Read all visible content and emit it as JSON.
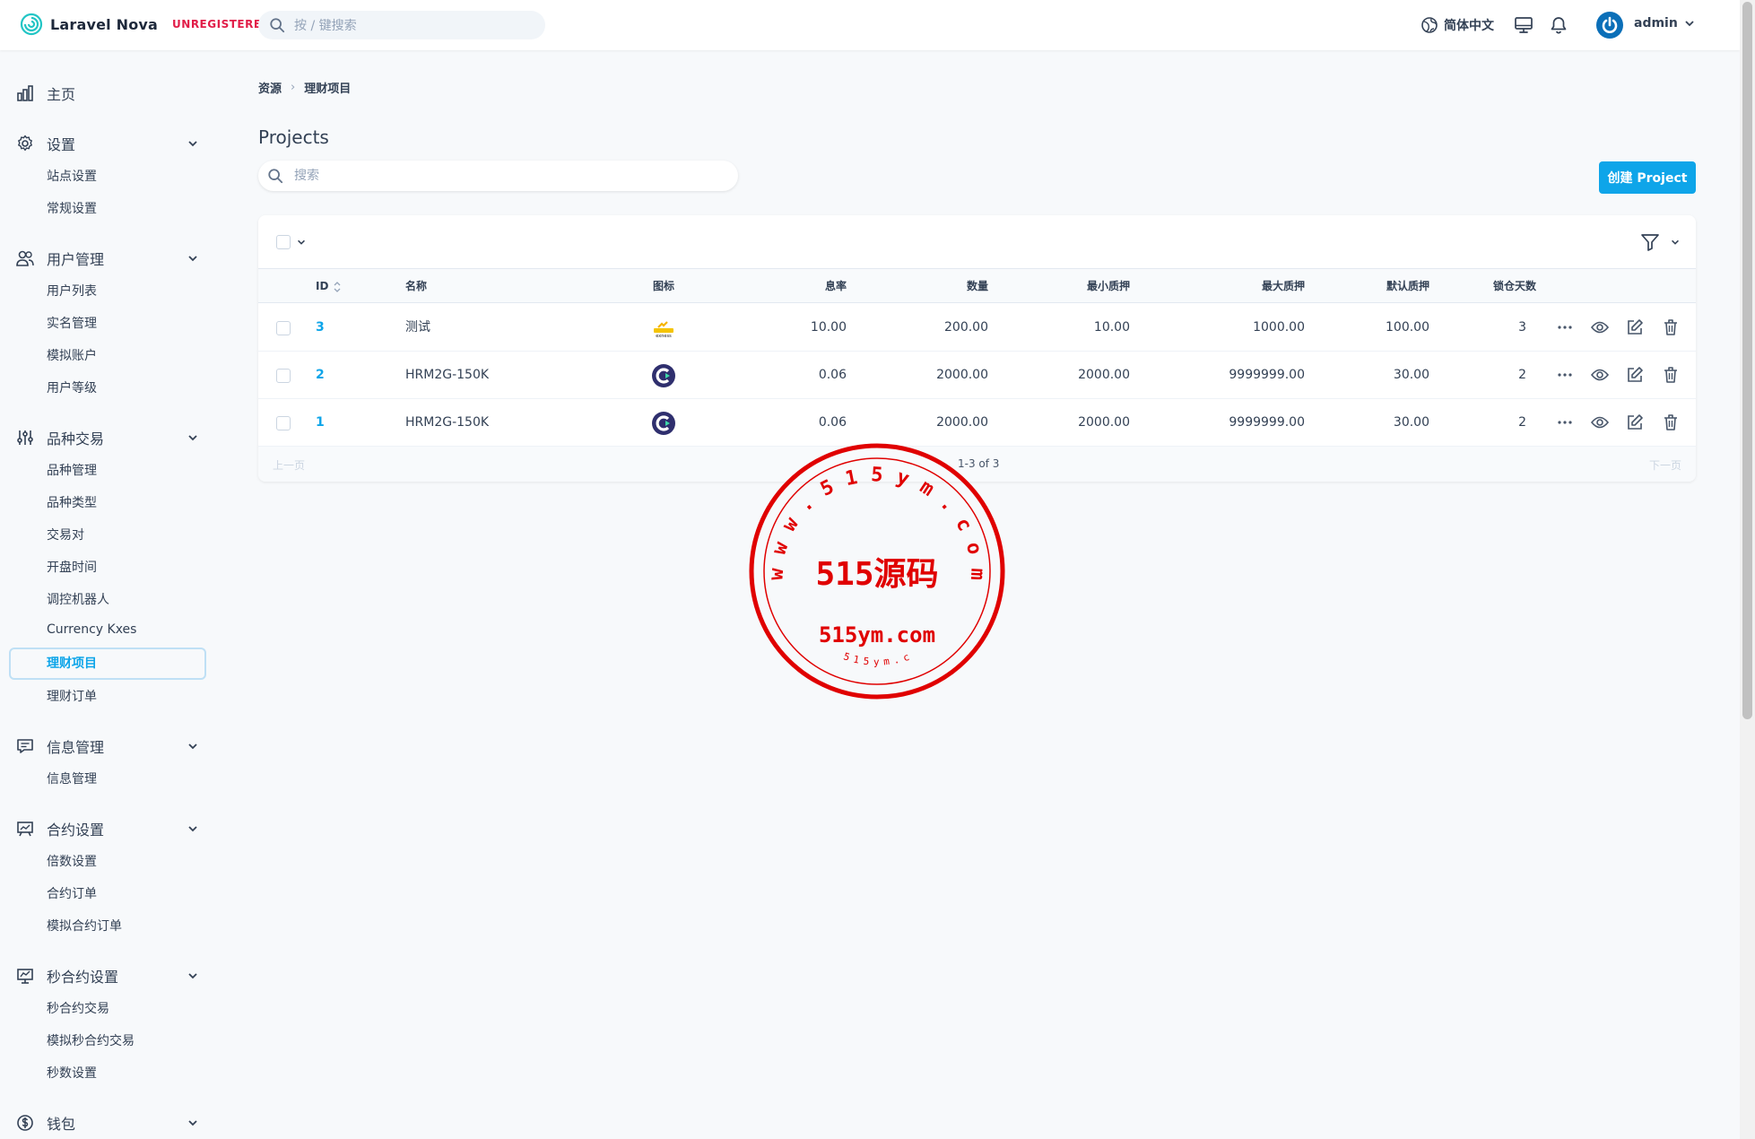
{
  "app": {
    "name": "Laravel Nova",
    "badge": "UNREGISTERED",
    "search_placeholder": "按 / 键搜索",
    "language": "简体中文",
    "user": "admin"
  },
  "sidebar": {
    "home": "主页",
    "groups": [
      {
        "label": "设置",
        "icon": "gear-icon",
        "items": [
          "站点设置",
          "常规设置"
        ]
      },
      {
        "label": "用户管理",
        "icon": "users-icon",
        "items": [
          "用户列表",
          "实名管理",
          "模拟账户",
          "用户等级"
        ]
      },
      {
        "label": "品种交易",
        "icon": "sliders-icon",
        "items": [
          "品种管理",
          "品种类型",
          "交易对",
          "开盘时间",
          "调控机器人",
          "Currency Kxes",
          "理财项目",
          "理财订单"
        ]
      },
      {
        "label": "信息管理",
        "icon": "message-icon",
        "items": [
          "信息管理"
        ]
      },
      {
        "label": "合约设置",
        "icon": "presentation-icon",
        "items": [
          "倍数设置",
          "合约订单",
          "模拟合约订单"
        ]
      },
      {
        "label": "秒合约设置",
        "icon": "chart-icon",
        "items": [
          "秒合约交易",
          "模拟秒合约交易",
          "秒数设置"
        ]
      },
      {
        "label": "钱包",
        "icon": "dollar-icon",
        "items": []
      }
    ],
    "active": "理财项目"
  },
  "breadcrumb": [
    "资源",
    "理财项目"
  ],
  "page": {
    "title": "Projects",
    "search_placeholder": "搜索",
    "create_label": "创建 Project"
  },
  "table": {
    "headers": {
      "id": "ID",
      "name": "名称",
      "icon": "图标",
      "rate": "息率",
      "qty": "数量",
      "min": "最小质押",
      "max": "最大质押",
      "def": "默认质押",
      "days": "锁仓天数"
    },
    "rows": [
      {
        "id": "3",
        "name": "测试",
        "logo": "exness",
        "rate": "10.00",
        "qty": "200.00",
        "min": "10.00",
        "max": "1000.00",
        "def": "100.00",
        "days": "3"
      },
      {
        "id": "2",
        "name": "HRM2G-150K",
        "logo": "c-logo",
        "rate": "0.06",
        "qty": "2000.00",
        "min": "2000.00",
        "max": "9999999.00",
        "def": "30.00",
        "days": "2"
      },
      {
        "id": "1",
        "name": "HRM2G-150K",
        "logo": "c-logo",
        "rate": "0.06",
        "qty": "2000.00",
        "min": "2000.00",
        "max": "9999999.00",
        "def": "30.00",
        "days": "2"
      }
    ],
    "prev": "上一页",
    "next": "下一页",
    "page_info": "1-3 of 3"
  },
  "watermark": {
    "main": "515源码",
    "domain": "515ym.com",
    "ring_top": "www.515ym.com",
    "ring_bottom": "515ym.com"
  },
  "colors": {
    "accent": "#0ea5e9",
    "badge": "#e11d48",
    "seal": "#e00000"
  }
}
